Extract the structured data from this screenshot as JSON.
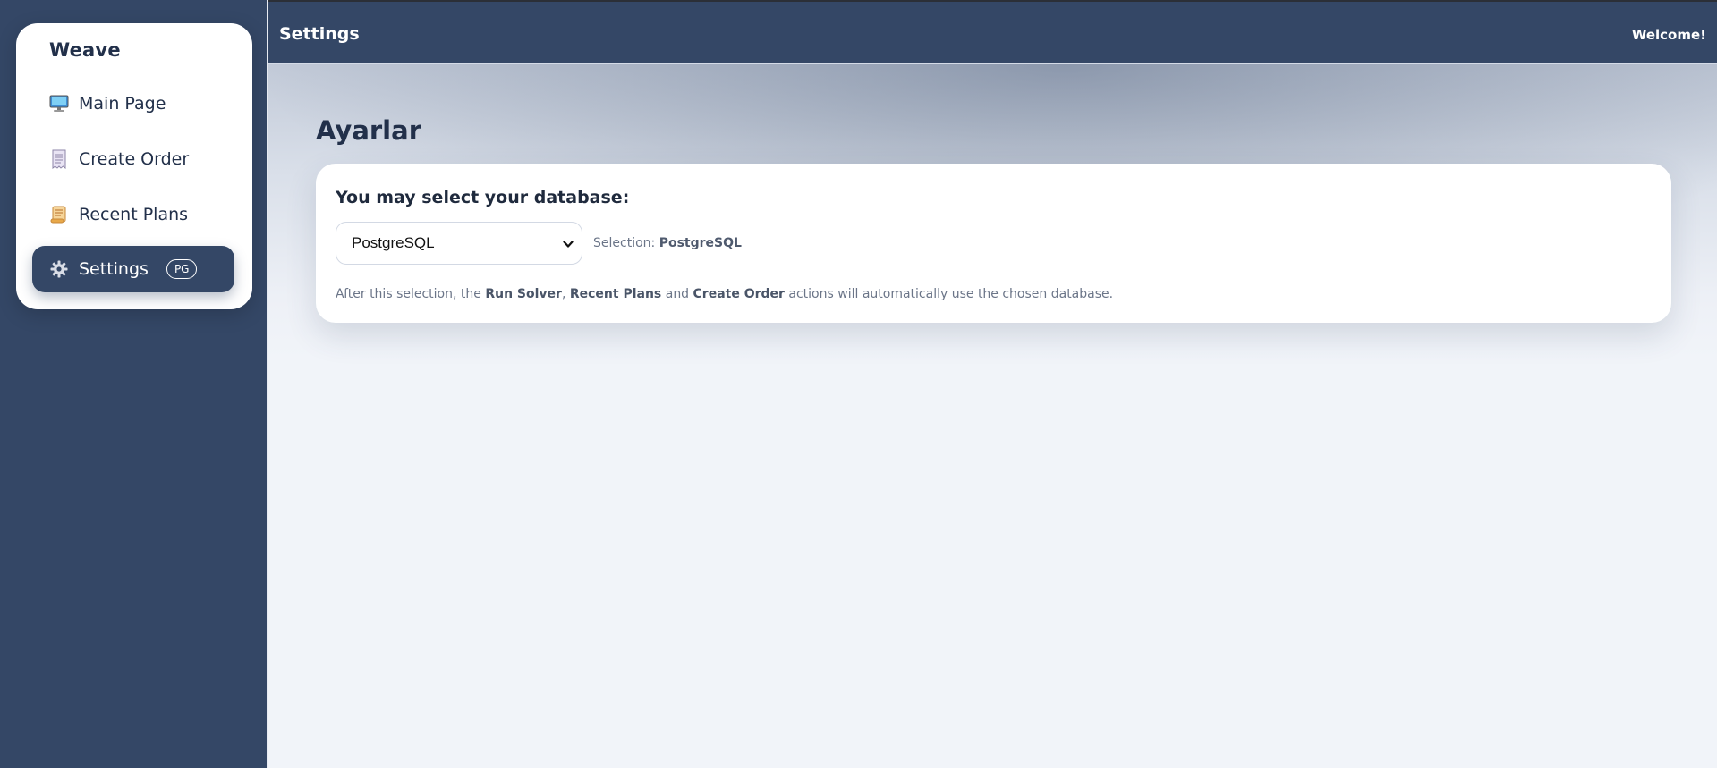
{
  "header": {
    "title": "Settings",
    "welcome": "Welcome!"
  },
  "sidebar": {
    "brand": "Weave",
    "items": [
      {
        "label": "Main Page",
        "icon": "desktop-computer-icon"
      },
      {
        "label": "Create Order",
        "icon": "receipt-icon"
      },
      {
        "label": "Recent Plans",
        "icon": "scroll-icon"
      },
      {
        "label": "Settings",
        "icon": "gear-icon",
        "badge": "PG",
        "active": true
      }
    ]
  },
  "main": {
    "heading": "Ayarlar",
    "card": {
      "title": "You may select your database:",
      "select_value": "PostgreSQL",
      "selection_label": "Selection:",
      "selection_value": "PostgreSQL",
      "help": {
        "prefix": "After this selection, the",
        "action1": "Run Solver",
        "sep1": ",",
        "action2": "Recent Plans",
        "and": "and",
        "action3": "Create Order",
        "suffix": "actions will automatically use the chosen database."
      }
    }
  },
  "colors": {
    "sidebar_bg": "#344766",
    "active_item_bg": "#344766",
    "page_bg": "#f1f4f9",
    "card_bg": "#ffffff",
    "text_dark": "#22304a"
  }
}
